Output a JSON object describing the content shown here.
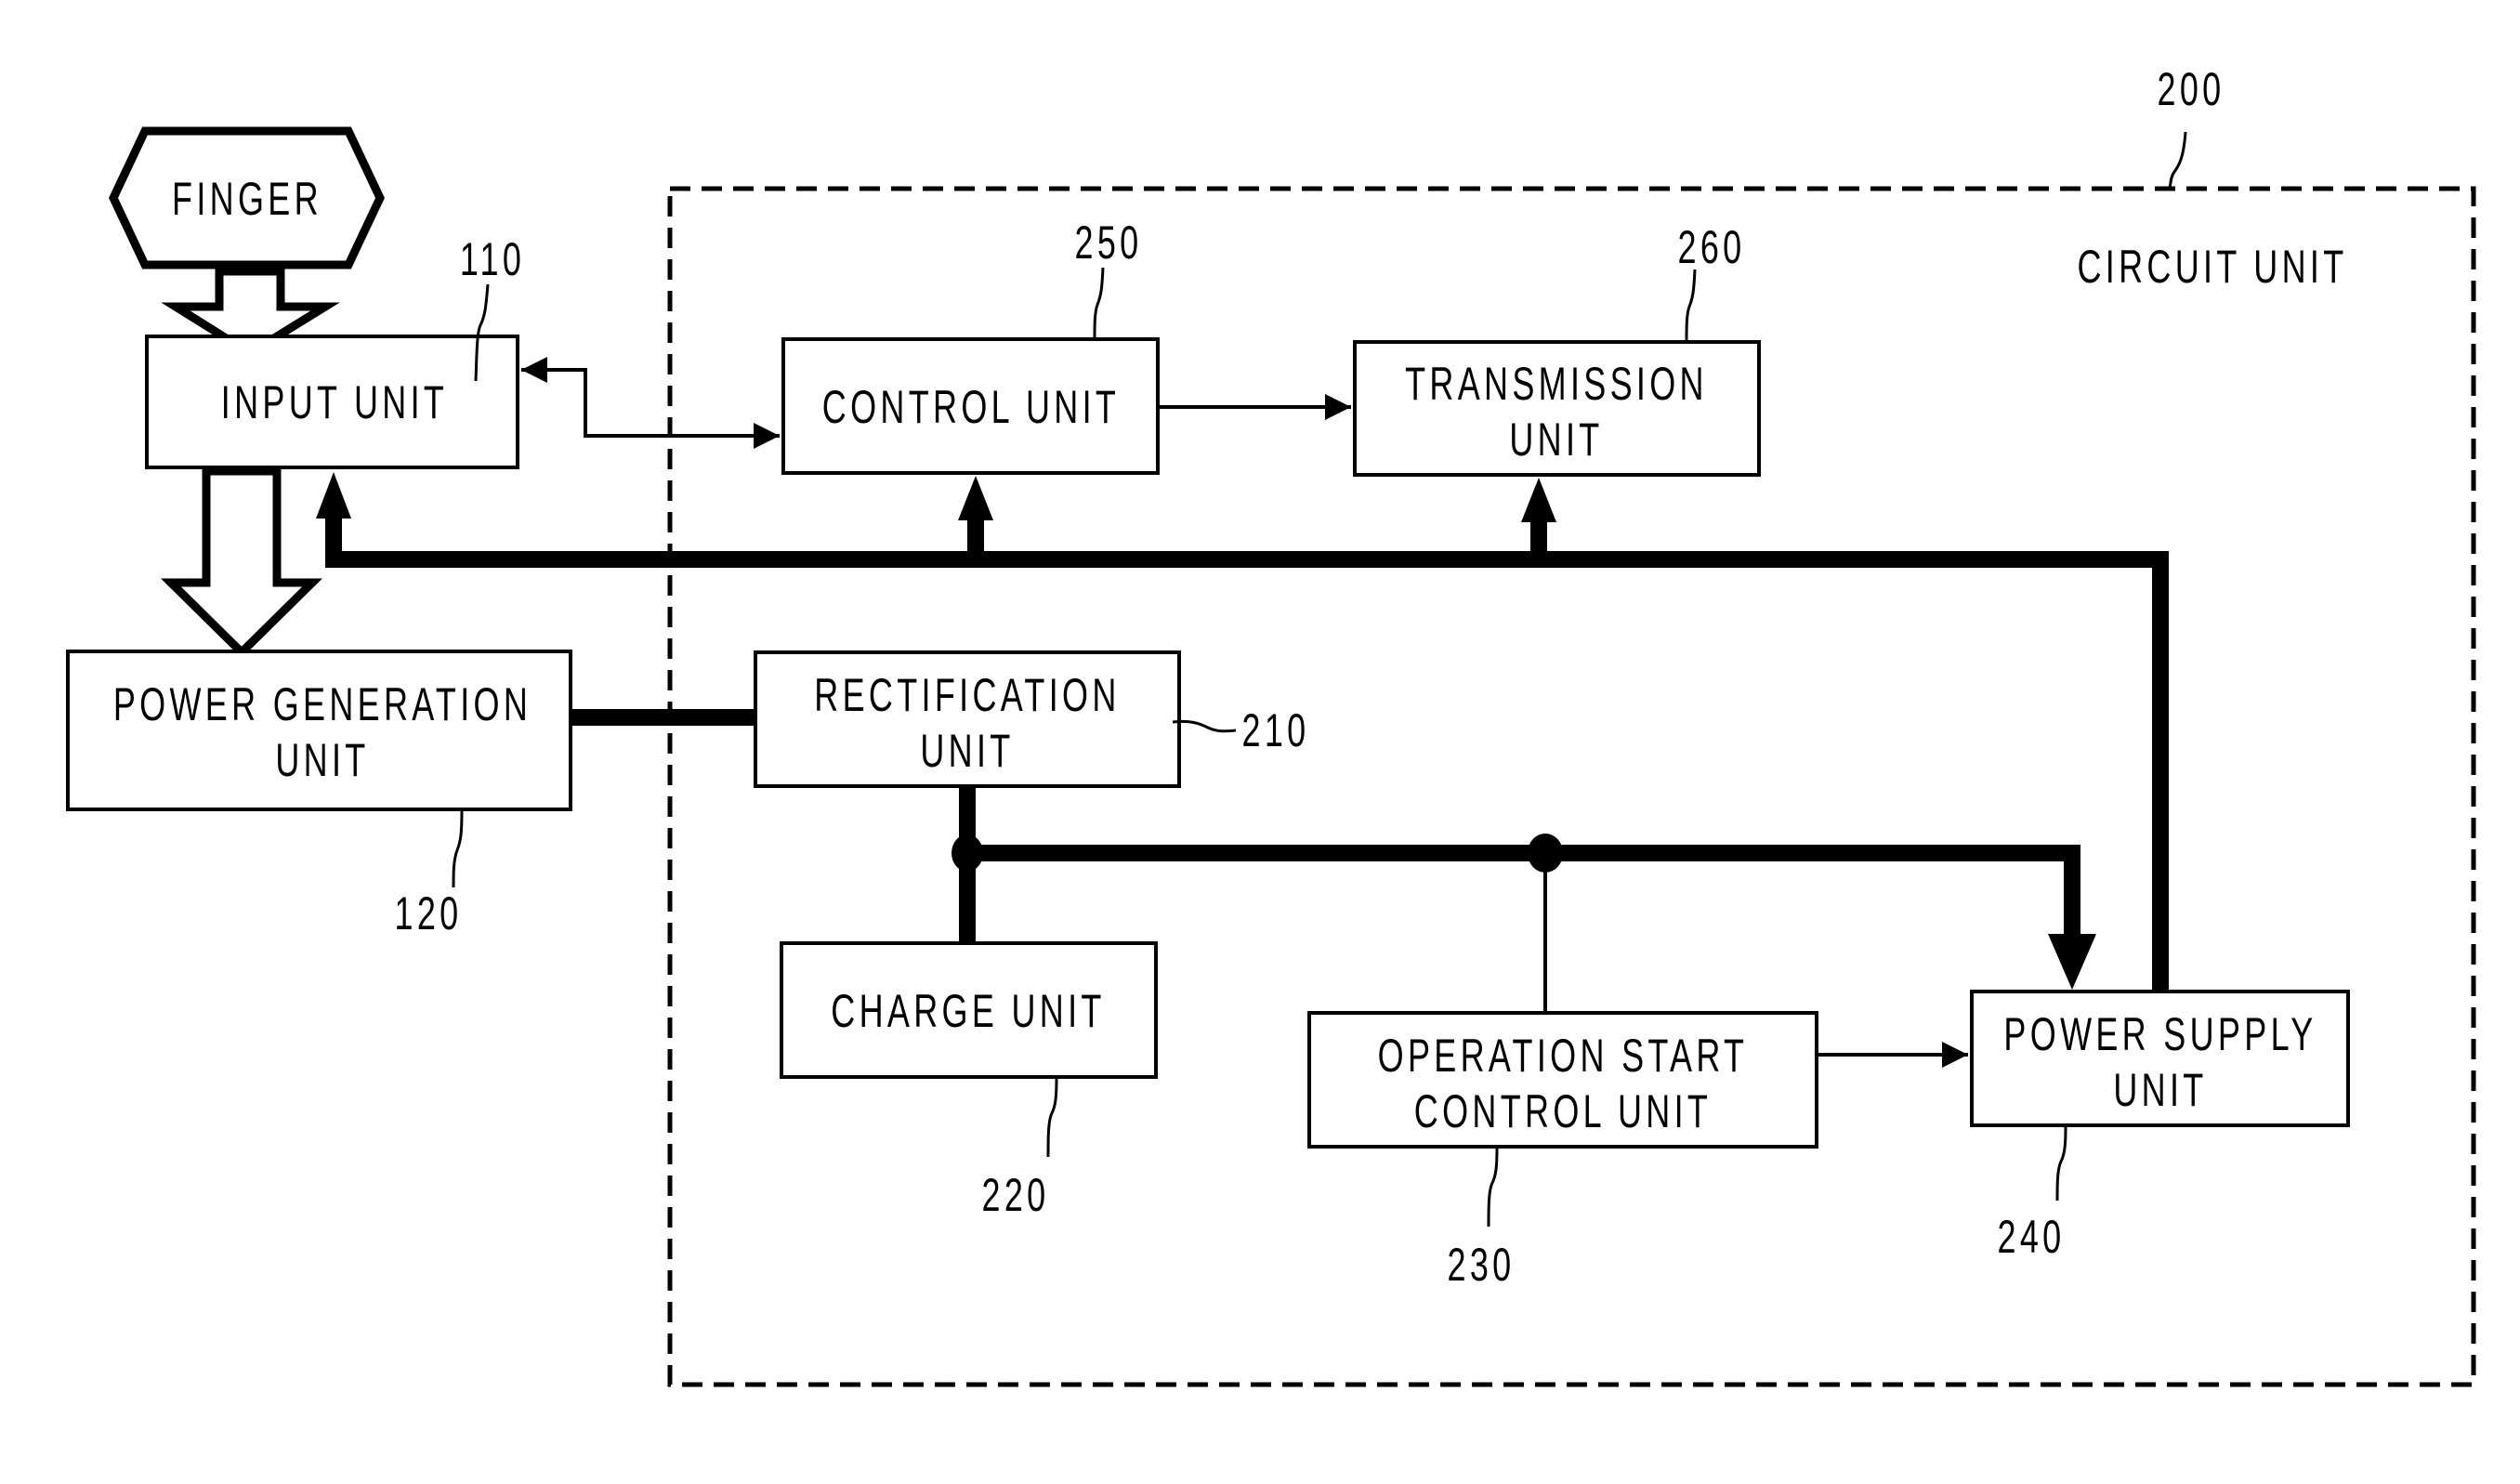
{
  "figure": {
    "type": "block-diagram",
    "container": {
      "label": "CIRCUIT UNIT",
      "ref": "200"
    },
    "blocks": {
      "finger": {
        "lines": [
          "FINGER"
        ]
      },
      "input_unit": {
        "lines": [
          "INPUT UNIT"
        ],
        "ref": "110"
      },
      "power_generation_unit": {
        "lines": [
          "POWER GENERATION",
          "UNIT"
        ],
        "ref": "120"
      },
      "rectification_unit": {
        "lines": [
          "RECTIFICATION",
          "UNIT"
        ],
        "ref": "210"
      },
      "charge_unit": {
        "lines": [
          "CHARGE UNIT"
        ],
        "ref": "220"
      },
      "operation_start_control_unit": {
        "lines": [
          "OPERATION START",
          "CONTROL UNIT"
        ],
        "ref": "230"
      },
      "power_supply_unit": {
        "lines": [
          "POWER SUPPLY",
          "UNIT"
        ],
        "ref": "240"
      },
      "control_unit": {
        "lines": [
          "CONTROL UNIT"
        ],
        "ref": "250"
      },
      "transmission_unit": {
        "lines": [
          "TRANSMISSION",
          "UNIT"
        ],
        "ref": "260"
      }
    },
    "connections": [
      {
        "from": "finger",
        "to": "input_unit",
        "style": "hollow-arrow"
      },
      {
        "from": "input_unit",
        "to": "power_generation_unit",
        "style": "hollow-arrow"
      },
      {
        "from": "input_unit",
        "to": "control_unit",
        "style": "thin-bidirectional"
      },
      {
        "from": "control_unit",
        "to": "transmission_unit",
        "style": "thin-arrow"
      },
      {
        "from": "power_generation_unit",
        "to": "rectification_unit",
        "style": "thick-line"
      },
      {
        "from": "rectification_unit",
        "to": "charge_unit",
        "style": "thick-line"
      },
      {
        "from": "rectification_unit",
        "to": "power_supply_unit",
        "style": "thick-arrow"
      },
      {
        "from": "rectification_unit",
        "to": "operation_start_control_unit",
        "style": "thin-line"
      },
      {
        "from": "operation_start_control_unit",
        "to": "power_supply_unit",
        "style": "thin-arrow"
      },
      {
        "from": "power_supply_unit",
        "to": "input_unit",
        "style": "thick-bus-arrow"
      },
      {
        "from": "power_supply_unit",
        "to": "control_unit",
        "style": "thick-bus-arrow"
      },
      {
        "from": "power_supply_unit",
        "to": "transmission_unit",
        "style": "thick-bus-arrow"
      }
    ]
  }
}
